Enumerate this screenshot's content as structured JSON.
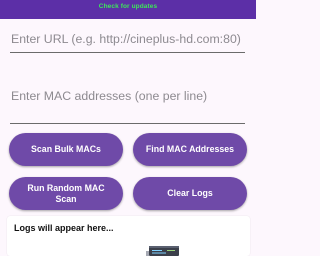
{
  "header": {
    "update_link": "Check for updates"
  },
  "form": {
    "url_placeholder": "Enter URL (e.g. http://cineplus-hd.com:80)",
    "mac_placeholder": "Enter MAC addresses (one per line)"
  },
  "actions": {
    "scan_bulk": "Scan Bulk MACs",
    "find_mac": "Find MAC Addresses",
    "run_random": "Run Random MAC Scan",
    "clear_logs": "Clear Logs"
  },
  "logs": {
    "placeholder": "Logs will appear here..."
  },
  "colors": {
    "header_bg": "#5c2fa7",
    "link_green": "#3ee65a",
    "button_bg": "#6f4aa8",
    "page_bg": "#fdf7fd"
  },
  "icons": {
    "logs_illustration": "console-illustration-icon"
  }
}
